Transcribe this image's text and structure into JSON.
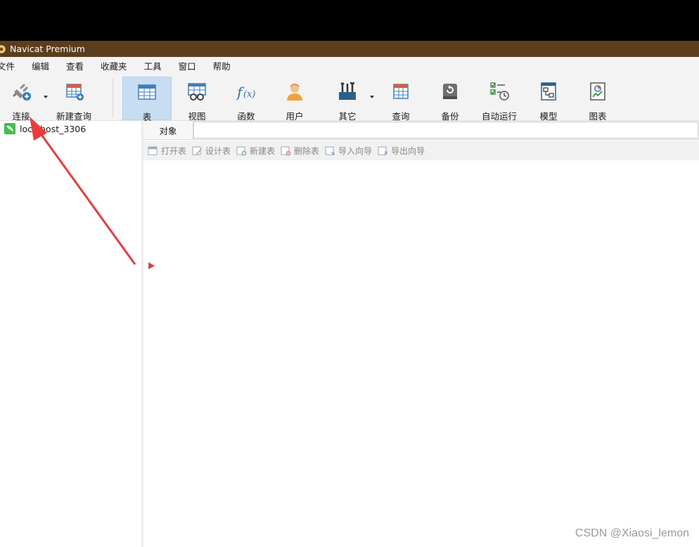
{
  "window": {
    "title": "Navicat Premium"
  },
  "menu": [
    "文件",
    "编辑",
    "查看",
    "收藏夹",
    "工具",
    "窗口",
    "帮助"
  ],
  "toolbar": {
    "connect": "连接",
    "new_query": "新建查询",
    "table": "表",
    "view": "视图",
    "function": "函数",
    "user": "用户",
    "other": "其它",
    "query": "查询",
    "backup": "备份",
    "auto_run": "自动运行",
    "model": "模型",
    "chart": "图表"
  },
  "connections": [
    {
      "name": "localhost_3306"
    }
  ],
  "tabs": {
    "objects": "对象"
  },
  "object_toolbar": {
    "open_table": "打开表",
    "design_table": "设计表",
    "new_table": "新建表",
    "delete_table": "删除表",
    "import_wizard": "导入向导",
    "export_wizard": "导出向导"
  },
  "watermark": "CSDN @Xiaosi_lemon",
  "colors": {
    "titlebar": "#5b3e1d",
    "active_tool": "#c6ddf2",
    "arrow": "#f03a3a"
  }
}
